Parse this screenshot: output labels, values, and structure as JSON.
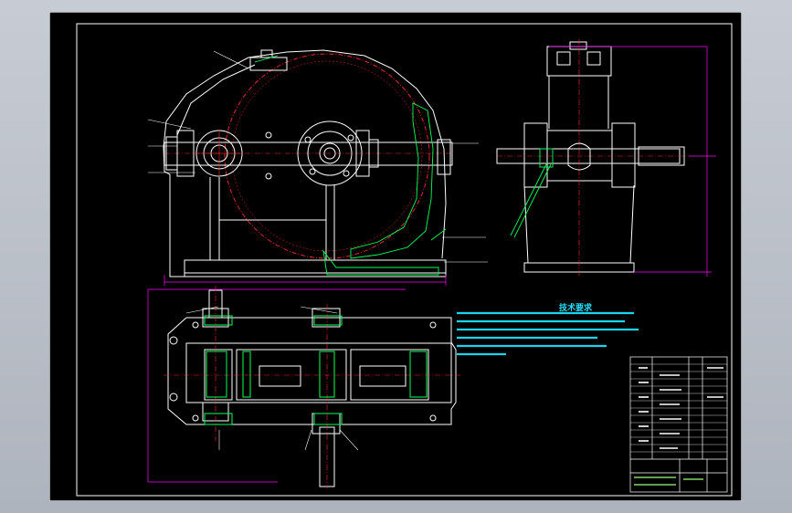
{
  "drawing": {
    "background_color": "#000000",
    "frame_color": "#ffffff",
    "main_line_color": "#ffffff",
    "dimension_color": "#ff00ff",
    "center_line_color": "#ff2a2a",
    "hatch_color": "#00ff5a",
    "text_color": "#19d7f0"
  },
  "technical_requirements": {
    "title": "技术要求"
  }
}
